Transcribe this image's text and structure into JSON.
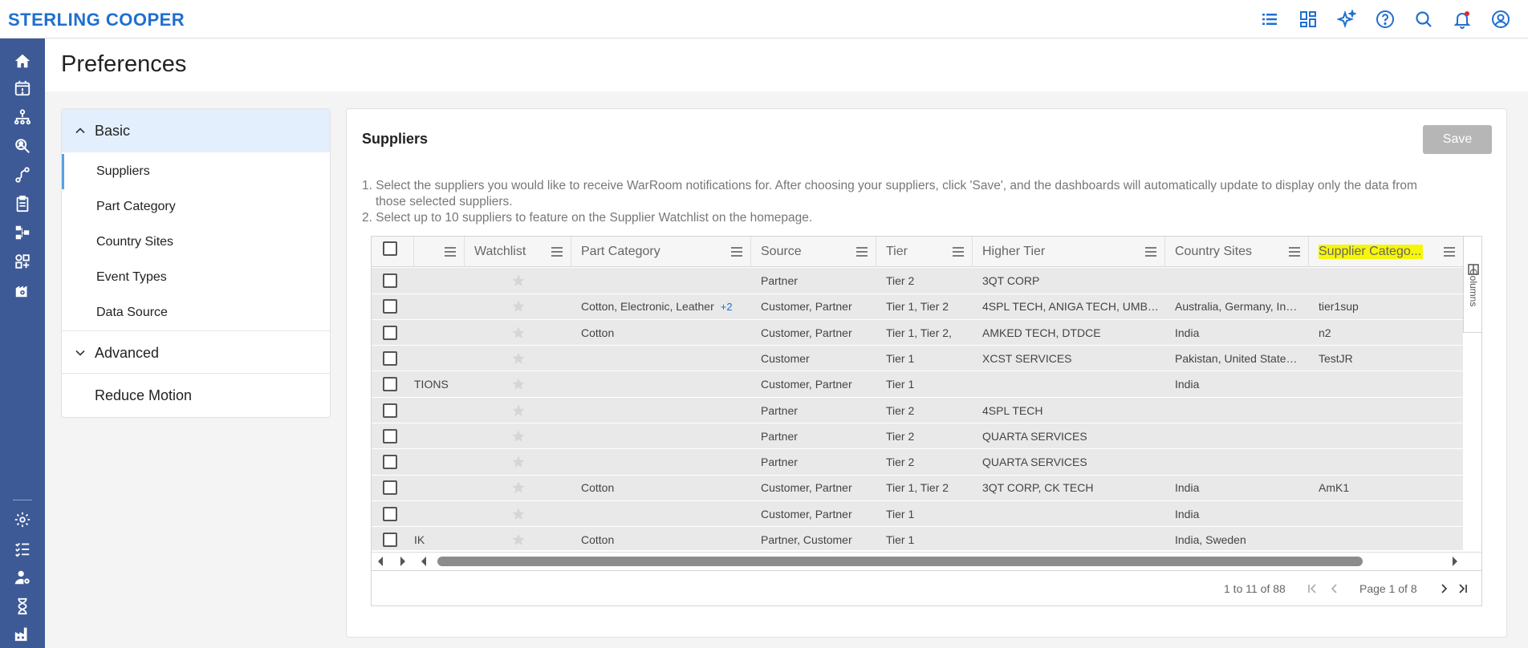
{
  "app": {
    "brand": "STERLING COOPER"
  },
  "topbar": {
    "icons": [
      "list-icon",
      "dashboard-icon",
      "sparkle-icon",
      "help-icon",
      "search-icon",
      "bell-icon",
      "user-icon"
    ]
  },
  "sidebar": {
    "icons_top": [
      "home-icon",
      "calendar-alert-icon",
      "network-icon",
      "search-people-icon",
      "route-icon",
      "clipboard-icon",
      "hierarchy-icon",
      "apps-icon",
      "building-gear-icon"
    ],
    "icons_bottom": [
      "settings-icon",
      "checklist-icon",
      "user-gear-icon",
      "hourglass-icon",
      "factory-icon"
    ]
  },
  "page": {
    "title": "Preferences"
  },
  "nav": {
    "basic_label": "Basic",
    "items": [
      {
        "label": "Suppliers",
        "active": true
      },
      {
        "label": "Part Category",
        "active": false
      },
      {
        "label": "Country Sites",
        "active": false
      },
      {
        "label": "Event Types",
        "active": false
      },
      {
        "label": "Data Source",
        "active": false
      }
    ],
    "advanced_label": "Advanced",
    "reduce_motion_label": "Reduce Motion"
  },
  "card": {
    "title": "Suppliers",
    "save_label": "Save",
    "instructions": [
      "1. Select the suppliers you would like to receive WarRoom notifications for. After choosing your suppliers, click 'Save', and the dashboards will automatically update to display only the data from",
      "those selected suppliers.",
      "2. Select up to 10 suppliers to feature on the Supplier Watchlist on the homepage."
    ]
  },
  "grid": {
    "columns": [
      "",
      "Watchlist",
      "Part Category",
      "Source",
      "Tier",
      "Higher Tier",
      "Country Sites",
      "Supplier Catego..."
    ],
    "columns_tab_label": "Columns",
    "rows": [
      {
        "name": "",
        "part": "",
        "more": "",
        "source": "Partner",
        "tier": "Tier 2",
        "higher": "3QT CORP",
        "country": "",
        "category": ""
      },
      {
        "name": "",
        "part": "Cotton, Electronic, Leather",
        "more": "+2",
        "source": "Customer, Partner",
        "tier": "Tier 1, Tier 2",
        "higher": "4SPL TECH, ANIGA TECH, UMB…",
        "country": "Australia, Germany, In…",
        "category": "tier1sup"
      },
      {
        "name": "",
        "part": "Cotton",
        "more": "",
        "source": "Customer, Partner",
        "tier": "Tier 1, Tier 2,",
        "higher": "AMKED TECH, DTDCE",
        "country": "India",
        "category": "n2"
      },
      {
        "name": "",
        "part": "",
        "more": "",
        "source": "Customer",
        "tier": "Tier 1",
        "higher": "XCST SERVICES",
        "country": "Pakistan, United State…",
        "category": "TestJR"
      },
      {
        "name": "TIONS",
        "part": "",
        "more": "",
        "source": "Customer, Partner",
        "tier": "Tier 1",
        "higher": "",
        "country": "India",
        "category": ""
      },
      {
        "name": "",
        "part": "",
        "more": "",
        "source": "Partner",
        "tier": "Tier 2",
        "higher": "4SPL TECH",
        "country": "",
        "category": ""
      },
      {
        "name": "",
        "part": "",
        "more": "",
        "source": "Partner",
        "tier": "Tier 2",
        "higher": "QUARTA SERVICES",
        "country": "",
        "category": ""
      },
      {
        "name": "",
        "part": "",
        "more": "",
        "source": "Partner",
        "tier": "Tier 2",
        "higher": "QUARTA SERVICES",
        "country": "",
        "category": ""
      },
      {
        "name": "",
        "part": "Cotton",
        "more": "",
        "source": "Customer, Partner",
        "tier": "Tier 1, Tier 2",
        "higher": "3QT CORP, CK TECH",
        "country": "India",
        "category": "AmK1"
      },
      {
        "name": "",
        "part": "",
        "more": "",
        "source": "Customer, Partner",
        "tier": "Tier 1",
        "higher": "",
        "country": "India",
        "category": ""
      },
      {
        "name": "IK",
        "part": "Cotton",
        "more": "",
        "source": "Partner, Customer",
        "tier": "Tier 1",
        "higher": "",
        "country": "India, Sweden",
        "category": ""
      }
    ],
    "pager": {
      "count": "1 to 11 of 88",
      "page": "Page 1 of 8"
    }
  },
  "colors": {
    "brand": "#1f6fd0",
    "sidebar": "#3d5a96",
    "highlight": "#f6f60a",
    "nav_active_bg": "#e3effc"
  }
}
